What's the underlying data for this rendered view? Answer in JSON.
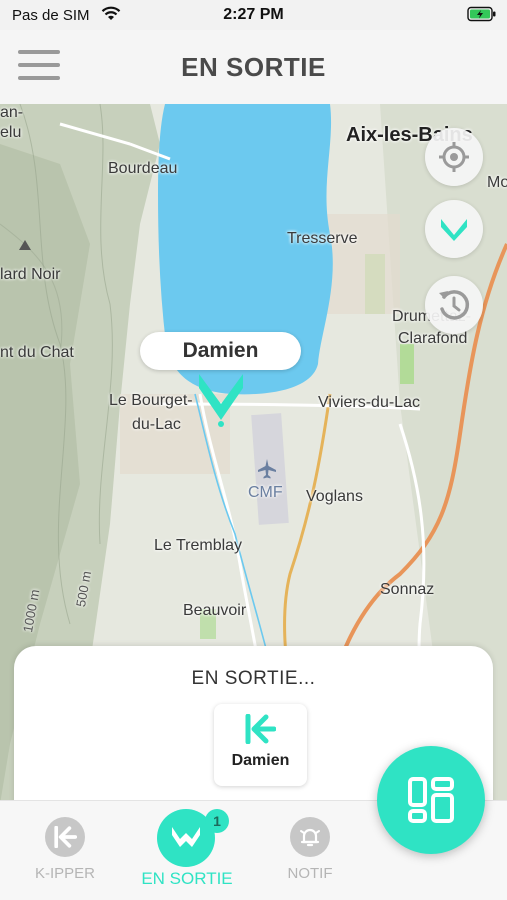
{
  "status_bar": {
    "carrier": "Pas de SIM",
    "time": "2:27 PM"
  },
  "header": {
    "title": "EN SORTIE",
    "menu_icon": "hamburger-menu-icon"
  },
  "map": {
    "places": [
      {
        "key": "aix",
        "label": "Aix-les-Bains"
      },
      {
        "key": "mo",
        "label": "Mo"
      },
      {
        "key": "bourdeau",
        "label": "Bourdeau"
      },
      {
        "key": "tresserve",
        "label": "Tresserve"
      },
      {
        "key": "lard",
        "label": "lard Noir"
      },
      {
        "key": "chat",
        "label": "nt du Chat"
      },
      {
        "key": "drumettaz",
        "label": "Drumettaz-"
      },
      {
        "key": "clarafond",
        "label": "Clarafond"
      },
      {
        "key": "bourget1",
        "label": "Le Bourget-"
      },
      {
        "key": "bourget2",
        "label": "du-Lac"
      },
      {
        "key": "viviers",
        "label": "Viviers-du-Lac"
      },
      {
        "key": "cmf",
        "label": "CMF"
      },
      {
        "key": "voglans",
        "label": "Voglans"
      },
      {
        "key": "tremblay",
        "label": "Le Tremblay"
      },
      {
        "key": "sonnaz",
        "label": "Sonnaz"
      },
      {
        "key": "beauvoir",
        "label": "Beauvoir"
      },
      {
        "key": "an",
        "label": "an-"
      },
      {
        "key": "elu",
        "label": "elu"
      },
      {
        "key": "m500",
        "label": "500 m"
      },
      {
        "key": "m1000",
        "label": "1000 m"
      }
    ],
    "user_bubble": "Damien",
    "controls": [
      "locate-icon",
      "chevron-down-icon",
      "history-icon"
    ]
  },
  "sheet": {
    "title": "EN SORTIE...",
    "card_name": "Damien"
  },
  "nav": {
    "items": [
      {
        "label": "K-IPPER",
        "icon": "k-ipper-icon"
      },
      {
        "label": "EN SORTIE",
        "icon": "en-sortie-icon",
        "badge": "1"
      },
      {
        "label": "NOTIF",
        "icon": "bell-icon"
      }
    ]
  },
  "colors": {
    "accent": "#2fe3c4",
    "lake": "#6cc9ef",
    "terrain": "#c9d3bd"
  }
}
